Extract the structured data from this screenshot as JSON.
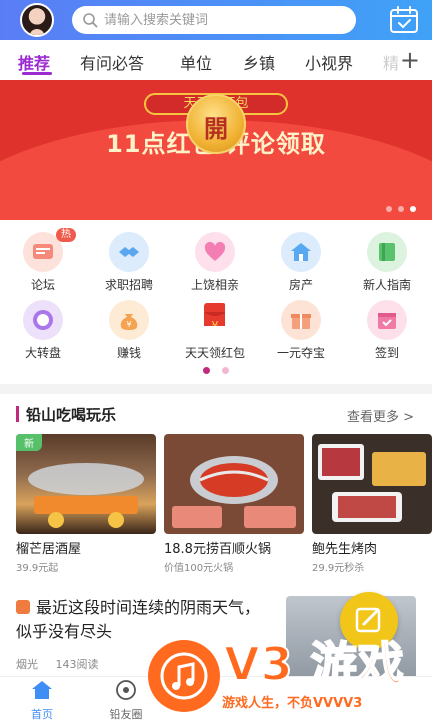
{
  "header": {
    "search_placeholder": "请输入搜索关键词"
  },
  "tabs": [
    {
      "label": "推荐"
    },
    {
      "label": "有问必答"
    },
    {
      "label": "单位"
    },
    {
      "label": "乡镇"
    },
    {
      "label": "小视界"
    },
    {
      "label": "精"
    }
  ],
  "banner": {
    "pill": "天天领红包",
    "title": "11点红包 评论领取",
    "coin": "開"
  },
  "grid": [
    {
      "label": "论坛",
      "icon": "forum-icon",
      "color": "#f58a7a",
      "badge": "热"
    },
    {
      "label": "求职招聘",
      "icon": "handshake-icon",
      "color": "#5ba6f0"
    },
    {
      "label": "上饶相亲",
      "icon": "heart-icon",
      "color": "#f47eb3"
    },
    {
      "label": "房产",
      "icon": "house-icon",
      "color": "#59a8f2"
    },
    {
      "label": "新人指南",
      "icon": "book-icon",
      "color": "#58c26c"
    },
    {
      "label": "大转盘",
      "icon": "wheel-icon",
      "color": "#a977ea"
    },
    {
      "label": "赚钱",
      "icon": "money-bag-icon",
      "color": "#f5a350"
    },
    {
      "label": "天天领红包",
      "icon": "red-envelope-icon",
      "color": "#e63a2f"
    },
    {
      "label": "一元夺宝",
      "icon": "gift-icon",
      "color": "#f4a07a"
    },
    {
      "label": "签到",
      "icon": "calendar-check-icon",
      "color": "#f07aa5"
    }
  ],
  "section": {
    "title": "铅山吃喝玩乐",
    "more": "查看更多"
  },
  "cards": [
    {
      "title": "榴芒居酒屋",
      "sub": "39.9元起",
      "badge": "新"
    },
    {
      "title": "18.8元捞百顺火锅",
      "sub": "价值100元火锅"
    },
    {
      "title": "鲍先生烤肉",
      "sub": "29.9元秒杀"
    }
  ],
  "article": {
    "title": "最近这段时间连续的阴雨天气，似乎没有尽头",
    "author": "烟光",
    "reads": "143阅读"
  },
  "bottom_nav": [
    {
      "label": "首页"
    },
    {
      "label": "铅友圈"
    }
  ],
  "watermark": {
    "big": "V3 游戏",
    "small": "游戏人生，不负VVVV3"
  },
  "colors": {
    "accent": "#9b2bd1",
    "header": "#4a8ef5"
  }
}
